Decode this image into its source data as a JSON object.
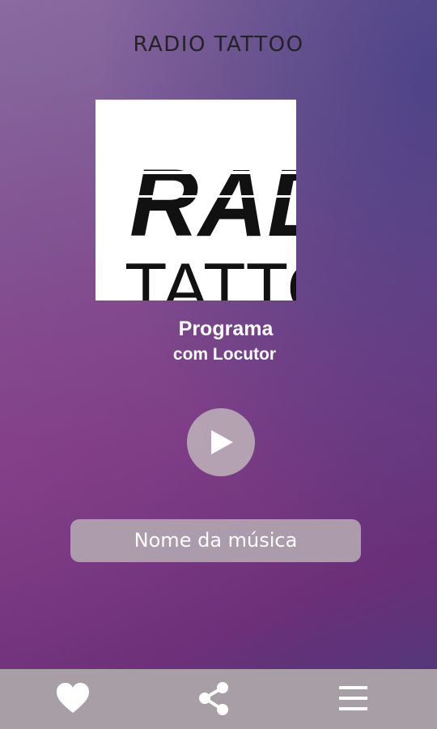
{
  "header": {
    "title": "RADIO TATTOO"
  },
  "logo": {
    "line1": "RADIO",
    "line2": "TATTOO"
  },
  "program": {
    "title": "Programa",
    "host": "com Locutor"
  },
  "player": {
    "play_icon": "play-icon",
    "song_name": "Nome da música"
  },
  "bottom_nav": {
    "items": [
      {
        "icon": "heart-icon"
      },
      {
        "icon": "share-icon"
      },
      {
        "icon": "menu-icon"
      }
    ]
  },
  "colors": {
    "nav_background": "#a89fa6",
    "text": "#ffffff",
    "title": "#232323"
  }
}
